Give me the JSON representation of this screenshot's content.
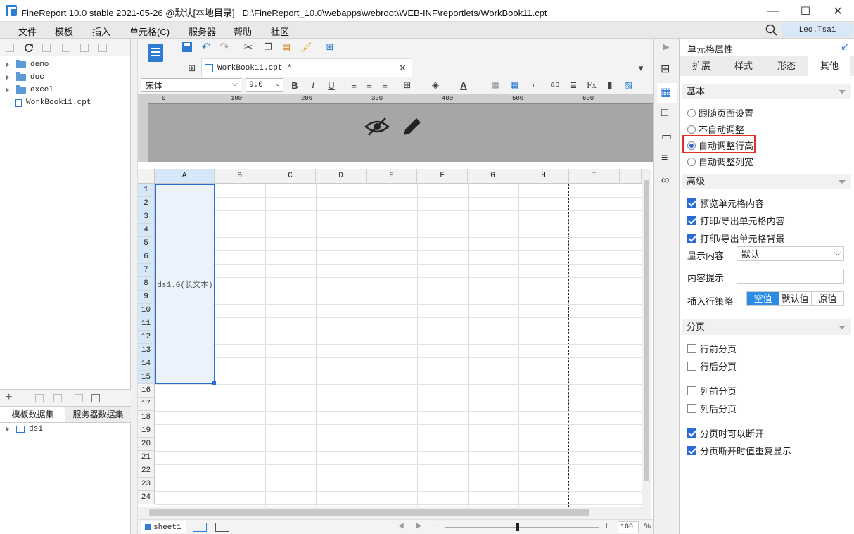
{
  "window": {
    "title": "FineReport 10.0 stable 2021-05-26 @默认[本地目录]   D:\\FineReport_10.0\\webapps\\webroot\\WEB-INF\\reportlets/WorkBook11.cpt",
    "minimize": "—",
    "maximize": "☐",
    "close": "✕"
  },
  "menu": [
    "文件",
    "模板",
    "插入",
    "单元格(C)",
    "服务器",
    "帮助",
    "社区"
  ],
  "user": "Leo.Tsai",
  "tree": [
    "demo",
    "doc",
    "excel",
    "WorkBook11.cpt"
  ],
  "dataset_tabs": [
    "模板数据集",
    "服务器数据集"
  ],
  "datasets": [
    "ds1"
  ],
  "doc_tab": "WorkBook11.cpt *",
  "format": {
    "font": "宋体",
    "size": "9.0"
  },
  "ruler_ticks": [
    "0",
    "100",
    "200",
    "300",
    "400",
    "500",
    "600"
  ],
  "columns": [
    "A",
    "B",
    "C",
    "D",
    "E",
    "F",
    "G",
    "H",
    "I"
  ],
  "rows": [
    "1",
    "2",
    "3",
    "4",
    "5",
    "6",
    "7",
    "8",
    "9",
    "10",
    "11",
    "12",
    "13",
    "14",
    "15",
    "16",
    "17",
    "18",
    "19",
    "20",
    "21",
    "22",
    "23",
    "24"
  ],
  "cell_A": "ds1.G(长文本)",
  "sheet_tab": "sheet1",
  "zoom": "100",
  "zoom_unit": "%",
  "right_panel": {
    "title": "单元格属性",
    "tabs": [
      "扩展",
      "样式",
      "形态",
      "其他"
    ],
    "active_tab": 3,
    "basic_title": "基本",
    "basic_options": [
      "跟随页面设置",
      "不自动调整",
      "自动调整行高",
      "自动调整列宽"
    ],
    "basic_selected": 2,
    "advanced_title": "高级",
    "advanced_checks": [
      "预览单元格内容",
      "打印/导出单元格内容",
      "打印/导出单元格背景"
    ],
    "display_label": "显示内容",
    "display_value": "默认",
    "tip_label": "内容提示",
    "insert_label": "插入行策略",
    "insert_options": [
      "空值",
      "默认值",
      "原值"
    ],
    "paging_title": "分页",
    "paging_checks": [
      "行前分页",
      "行后分页",
      "列前分页",
      "列后分页"
    ],
    "paging_break": [
      "分页时可以断开",
      "分页断开时值重复显示"
    ]
  },
  "colors": {
    "accent": "#2b6bd6",
    "highlight_box": "#e0302a",
    "selection": "#eaf3fc"
  }
}
